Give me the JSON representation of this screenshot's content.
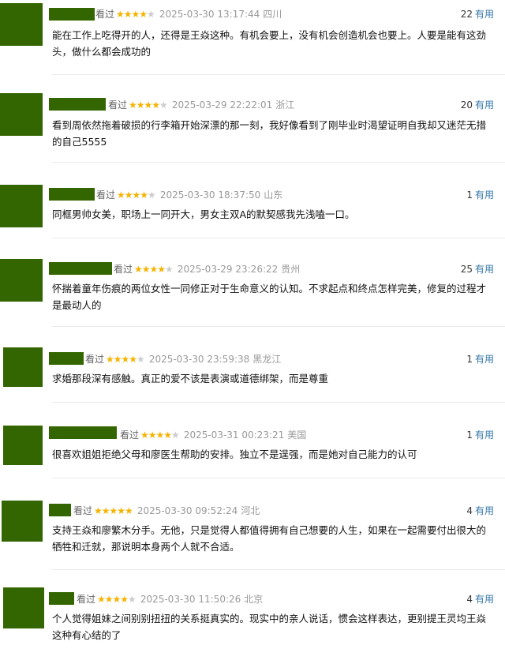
{
  "reviews": [
    {
      "watched": "看过",
      "rating": 4,
      "time": "2025-03-30 13:17:44",
      "location": "四川",
      "votes": "22",
      "useful": "有用",
      "text": "能在工作上吃得开的人，还得是王焱这种。有机会要上，没有机会创造机会也要上。人要是能有这劲头，做什么都会成功的"
    },
    {
      "watched": "看过",
      "rating": 4,
      "time": "2025-03-29 22:22:01",
      "location": "浙江",
      "votes": "20",
      "useful": "有用",
      "text": "看到周依然拖着破损的行李箱开始深漂的那一刻，我好像看到了刚毕业时渴望证明自我却又迷茫无措的自己5555"
    },
    {
      "watched": "看过",
      "rating": 4,
      "time": "2025-03-30 18:37:50",
      "location": "山东",
      "votes": "1",
      "useful": "有用",
      "text": "同框男帅女美，职场上一同开大，男女主双A的默契感我先浅嗑一口。"
    },
    {
      "watched": "看过",
      "rating": 4,
      "time": "2025-03-29 23:26:22",
      "location": "贵州",
      "votes": "25",
      "useful": "有用",
      "text": "怀揣着童年伤痕的两位女性一同修正对于生命意义的认知。不求起点和终点怎样完美，修复的过程才是最动人的"
    },
    {
      "watched": "看过",
      "rating": 4,
      "time": "2025-03-30 23:59:38",
      "location": "黑龙江",
      "votes": "1",
      "useful": "有用",
      "text": "求婚那段深有感触。真正的爱不该是表演或道德绑架，而是尊重"
    },
    {
      "watched": "看过",
      "rating": 4,
      "time": "2025-03-31 00:23:21",
      "location": "美国",
      "votes": "1",
      "useful": "有用",
      "text": "很喜欢姐姐拒绝父母和廖医生帮助的安排。独立不是逞强，而是她对自己能力的认可"
    },
    {
      "watched": "看过",
      "rating": 5,
      "time": "2025-03-30 09:52:24",
      "location": "河北",
      "votes": "4",
      "useful": "有用",
      "text": "支持王焱和廖繁木分手。无他，只是觉得人都值得拥有自己想要的人生，如果在一起需要付出很大的牺牲和迁就，那说明本身两个人就不合适。"
    },
    {
      "watched": "看过",
      "rating": 4,
      "time": "2025-03-30 11:50:26",
      "location": "北京",
      "votes": "4",
      "useful": "有用",
      "text": "个人觉得姐妹之间别别扭扭的关系挺真实的。现实中的亲人说话，惯会这样表达，更别提王灵均王焱这种有心结的了"
    }
  ]
}
